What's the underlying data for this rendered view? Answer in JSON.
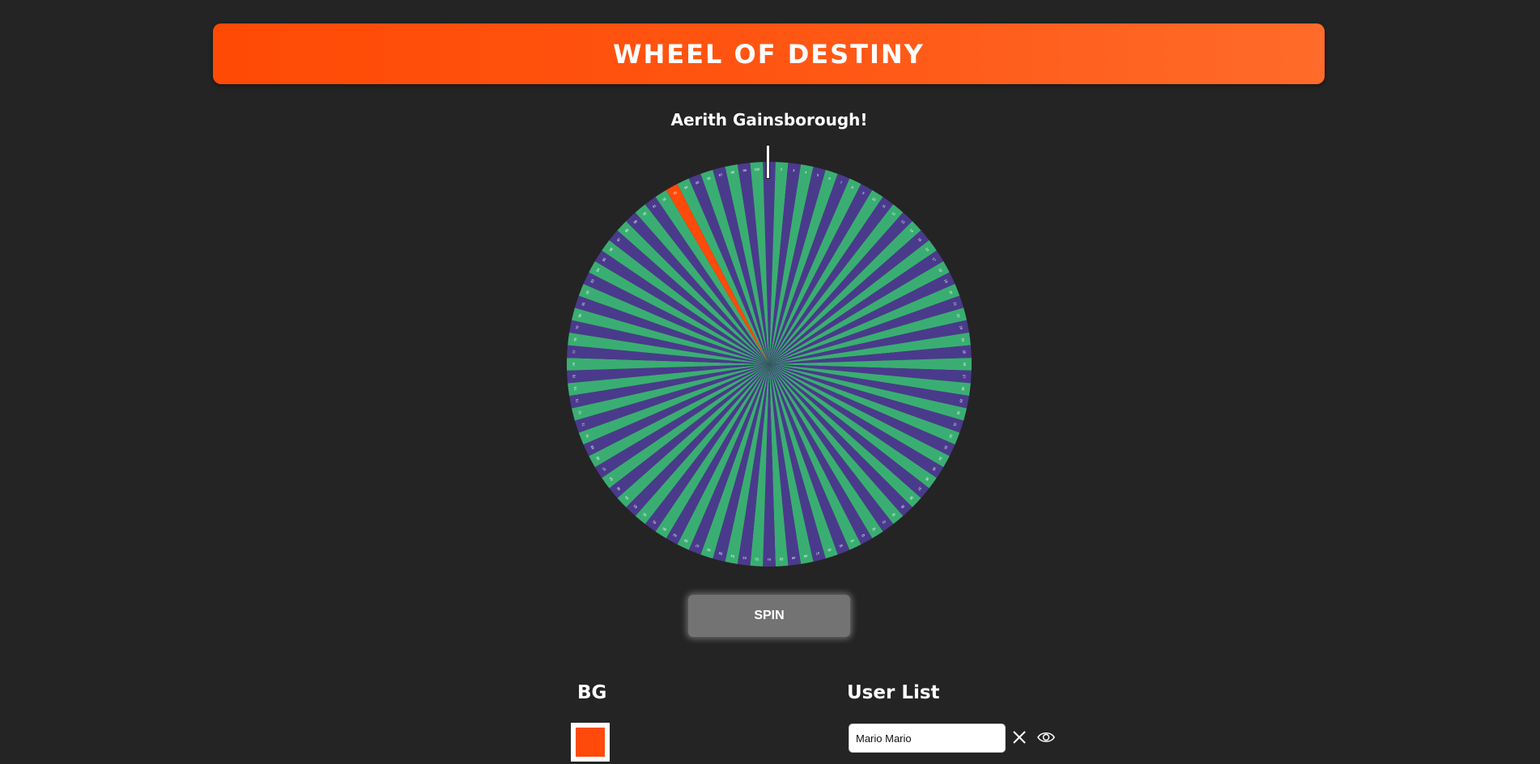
{
  "header": {
    "title": "WHEEL OF DESTINY"
  },
  "result": {
    "winner_text": "Aerith Gainsborough!"
  },
  "wheel": {
    "segment_count": 100,
    "labels_shown": "1–100",
    "colors": {
      "even": "#4a3a8c",
      "odd": "#3aae72",
      "highlight": "#ff4a0b",
      "label_text": "#ffffff"
    },
    "highlighted_segment": 93
  },
  "controls": {
    "spin_label": "SPIN"
  },
  "bg_section": {
    "heading": "BG",
    "color": "#ff4a0b"
  },
  "user_list": {
    "heading": "User List",
    "entries": [
      {
        "value": "Mario Mario"
      }
    ]
  },
  "colors": {
    "page_bg": "#242424",
    "accent": "#ff4a0b",
    "button_bg": "#737373"
  }
}
